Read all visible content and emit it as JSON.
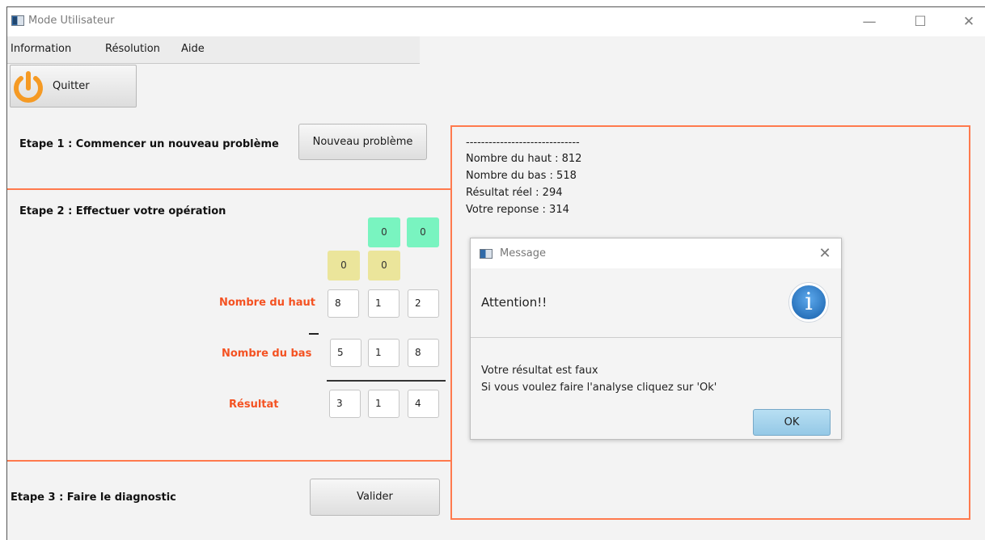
{
  "window": {
    "title": "Mode Utilisateur",
    "controls": {
      "minimize": "—",
      "maximize": "☐",
      "close": "✕"
    }
  },
  "menu": {
    "items": [
      {
        "label": "Information"
      },
      {
        "label": "Résolution"
      },
      {
        "label": "Aide"
      }
    ]
  },
  "toolbar": {
    "quit_label": "Quitter",
    "quit_icon_color": "#f59a24"
  },
  "step1": {
    "label": "Etape 1 : Commencer un nouveau problème",
    "button_label": "Nouveau problème"
  },
  "step2": {
    "label": "Etape 2 : Effectuer votre opération",
    "carries_green": [
      "0",
      "0"
    ],
    "carries_yellow": [
      "0",
      "0"
    ],
    "top_label": "Nombre du haut",
    "top_digits": [
      "8",
      "1",
      "2"
    ],
    "operator": "—",
    "bottom_label": "Nombre du bas",
    "bottom_digits": [
      "5",
      "1",
      "8"
    ],
    "result_label": "Résultat",
    "result_digits": [
      "3",
      "1",
      "4"
    ]
  },
  "step3": {
    "label": "Etape 3 : Faire le diagnostic",
    "button_label": "Valider"
  },
  "output": {
    "lines": [
      "------------------------------",
      "Nombre du haut : 812",
      "Nombre du bas : 518",
      "Résultat réel : 294",
      "Votre reponse : 314"
    ]
  },
  "dialog": {
    "title": "Message",
    "close_symbol": "✕",
    "header_text": "Attention!!",
    "info_symbol": "i",
    "message_lines": [
      "Votre résultat est faux",
      "Si vous voulez faire l'analyse cliquez sur 'Ok'"
    ],
    "ok_label": "OK"
  },
  "colors": {
    "accent": "#ff7a4d",
    "label_red": "#f45222",
    "carry_green": "#79f4c0",
    "carry_yellow": "#ebe59b",
    "info_blue": "#1f6fb8",
    "ok_button": "#a9d6ef"
  }
}
